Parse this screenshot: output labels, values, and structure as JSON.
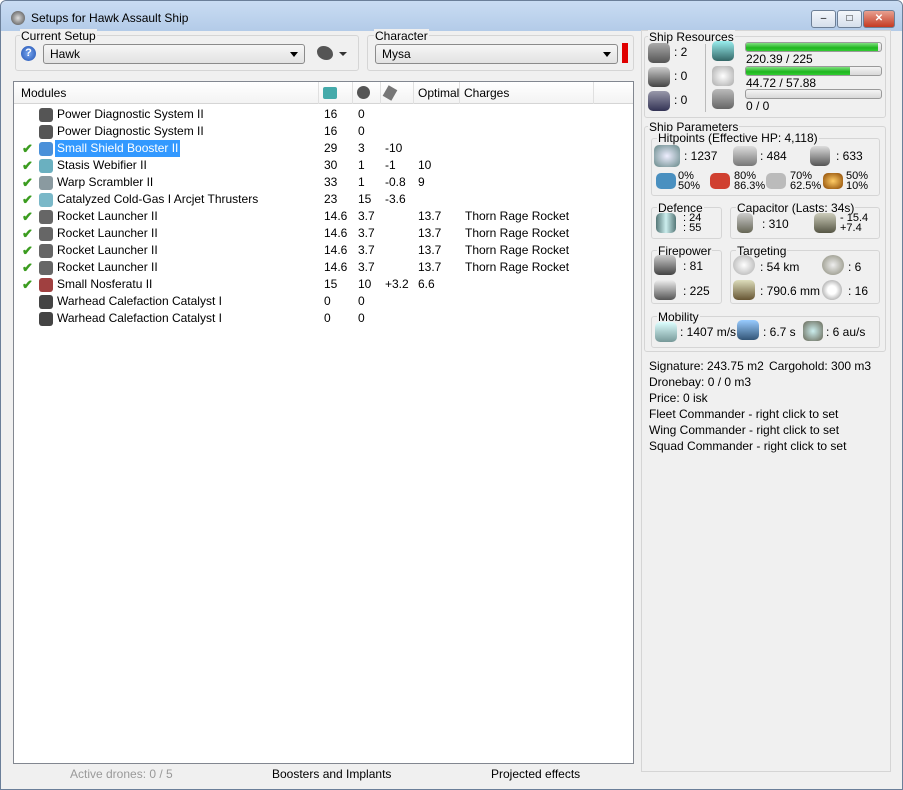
{
  "window": {
    "title": "Setups for Hawk Assault Ship",
    "min": "–",
    "max": "□",
    "close": "✕"
  },
  "setup": {
    "legend": "Current Setup",
    "value": "Hawk"
  },
  "character": {
    "legend": "Character",
    "value": "Mysa",
    "status_color": "#e00000"
  },
  "modules": {
    "headers": [
      "Modules",
      "",
      "",
      "",
      "Optimal",
      "Charges"
    ],
    "header_icons": [
      "cpu-icon",
      "powergrid-icon",
      "capacitor-icon"
    ],
    "rows": [
      {
        "active": false,
        "name": "Power Diagnostic System II",
        "c1": "16",
        "c2": "0",
        "c3": "",
        "optimal": "",
        "charges": "",
        "color": "#555"
      },
      {
        "active": false,
        "name": "Power Diagnostic System II",
        "c1": "16",
        "c2": "0",
        "c3": "",
        "optimal": "",
        "charges": "",
        "color": "#555"
      },
      {
        "active": true,
        "name": "Small Shield Booster II",
        "c1": "29",
        "c2": "3",
        "c3": "-10",
        "optimal": "",
        "charges": "",
        "color": "#4a90d9",
        "selected": true
      },
      {
        "active": true,
        "name": "Stasis Webifier II",
        "c1": "30",
        "c2": "1",
        "c3": "-1",
        "optimal": "10",
        "charges": "",
        "color": "#6ab0c0"
      },
      {
        "active": true,
        "name": "Warp Scrambler II",
        "c1": "33",
        "c2": "1",
        "c3": "-0.8",
        "optimal": "9",
        "charges": "",
        "color": "#8a9aa0"
      },
      {
        "active": true,
        "name": "Catalyzed Cold-Gas I Arcjet Thrusters",
        "c1": "23",
        "c2": "15",
        "c3": "-3.6",
        "optimal": "",
        "charges": "",
        "color": "#7ab8c8"
      },
      {
        "active": true,
        "name": "Rocket Launcher II",
        "c1": "14.6",
        "c2": "3.7",
        "c3": "",
        "optimal": "13.7",
        "charges": "Thorn Rage Rocket",
        "color": "#666"
      },
      {
        "active": true,
        "name": "Rocket Launcher II",
        "c1": "14.6",
        "c2": "3.7",
        "c3": "",
        "optimal": "13.7",
        "charges": "Thorn Rage Rocket",
        "color": "#666"
      },
      {
        "active": true,
        "name": "Rocket Launcher II",
        "c1": "14.6",
        "c2": "3.7",
        "c3": "",
        "optimal": "13.7",
        "charges": "Thorn Rage Rocket",
        "color": "#666"
      },
      {
        "active": true,
        "name": "Rocket Launcher II",
        "c1": "14.6",
        "c2": "3.7",
        "c3": "",
        "optimal": "13.7",
        "charges": "Thorn Rage Rocket",
        "color": "#666"
      },
      {
        "active": true,
        "name": "Small Nosferatu II",
        "c1": "15",
        "c2": "10",
        "c3": "+3.2",
        "optimal": "6.6",
        "charges": "",
        "color": "#a04040"
      },
      {
        "active": false,
        "name": "Warhead Calefaction Catalyst I",
        "c1": "0",
        "c2": "0",
        "c3": "",
        "optimal": "",
        "charges": "",
        "color": "#444"
      },
      {
        "active": false,
        "name": "Warhead Calefaction Catalyst I",
        "c1": "0",
        "c2": "0",
        "c3": "",
        "optimal": "",
        "charges": "",
        "color": "#444"
      }
    ]
  },
  "bottom": {
    "drones": "Active drones: 0 / 5",
    "boosters": "Boosters and Implants",
    "projected": "Projected effects"
  },
  "resources": {
    "legend": "Ship Resources",
    "turrets": ": 2",
    "launchers": ": 0",
    "drones": ": 0",
    "cpu": "220.39 / 225",
    "cpu_fraction": 0.98,
    "pg": "44.72 / 57.88",
    "pg_fraction": 0.77,
    "drone_bw": "0 / 0",
    "drone_fraction": 0
  },
  "params": {
    "legend": "Ship Parameters",
    "hp_legend": "Hitpoints (Effective HP: 4,118)",
    "shield": ": 1237",
    "armor": ": 484",
    "structure": ": 633",
    "resists": [
      {
        "a": "0%",
        "b": "50%"
      },
      {
        "a": "80%",
        "b": "86.3%"
      },
      {
        "a": "70%",
        "b": "62.5%"
      },
      {
        "a": "50%",
        "b": "10%"
      }
    ],
    "defence_legend": "Defence",
    "def1": ": 24",
    "def2": ": 55",
    "cap_legend": "Capacitor (Lasts: 34s)",
    "cap": ": 310",
    "cap_use": "- 15.4",
    "cap_regen": "+7.4",
    "fire_legend": "Firepower",
    "dps_turret": ": 81",
    "dps_missile": ": 225",
    "target_legend": "Targeting",
    "range": ": 54 km",
    "max_targets": ": 6",
    "res": ": 790.6 mm",
    "scan": ": 16",
    "mob_legend": "Mobility",
    "speed": ": 1407 m/s",
    "align": ": 6.7 s",
    "warp": ": 6 au/s"
  },
  "info": {
    "signature": "Signature: 243.75 m2",
    "cargo": "Cargohold: 300 m3",
    "dronebay": "Dronebay: 0 / 0 m3",
    "price": "Price: 0 isk",
    "fleet": "Fleet Commander - right click to set",
    "wing": "Wing Commander - right click to set",
    "squad": "Squad Commander - right click to set"
  }
}
